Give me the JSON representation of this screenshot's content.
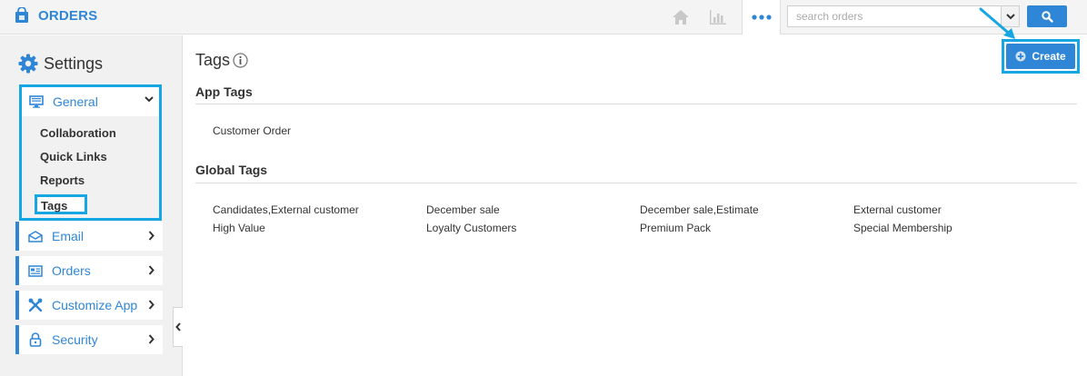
{
  "app": {
    "title": "ORDERS",
    "accent_color": "#2f86d6",
    "highlight_color": "#16a6e4"
  },
  "topbar": {
    "icons": [
      "home-icon",
      "chart-icon",
      "more-icon"
    ],
    "search": {
      "placeholder": "search orders",
      "value": ""
    },
    "search_button_icon": "search-icon"
  },
  "sidebar": {
    "title": "Settings",
    "general": {
      "label": "General",
      "icon": "monitor-icon",
      "subitems": [
        "Collaboration",
        "Quick Links",
        "Reports",
        "Tags"
      ],
      "selected": "Tags"
    },
    "items": [
      {
        "label": "Email",
        "icon": "envelope-icon"
      },
      {
        "label": "Orders",
        "icon": "orders-icon"
      },
      {
        "label": "Customize App",
        "icon": "tools-icon"
      },
      {
        "label": "Security",
        "icon": "lock-icon"
      }
    ]
  },
  "main": {
    "page_title": "Tags",
    "create_label": "Create",
    "app_tags": {
      "title": "App Tags",
      "tags": [
        "Customer Order"
      ]
    },
    "global_tags": {
      "title": "Global Tags",
      "tags": [
        "Candidates,External customer",
        "December sale",
        "December sale,Estimate",
        "External customer",
        "High Value",
        "Loyalty Customers",
        "Premium Pack",
        "Special Membership"
      ]
    }
  }
}
